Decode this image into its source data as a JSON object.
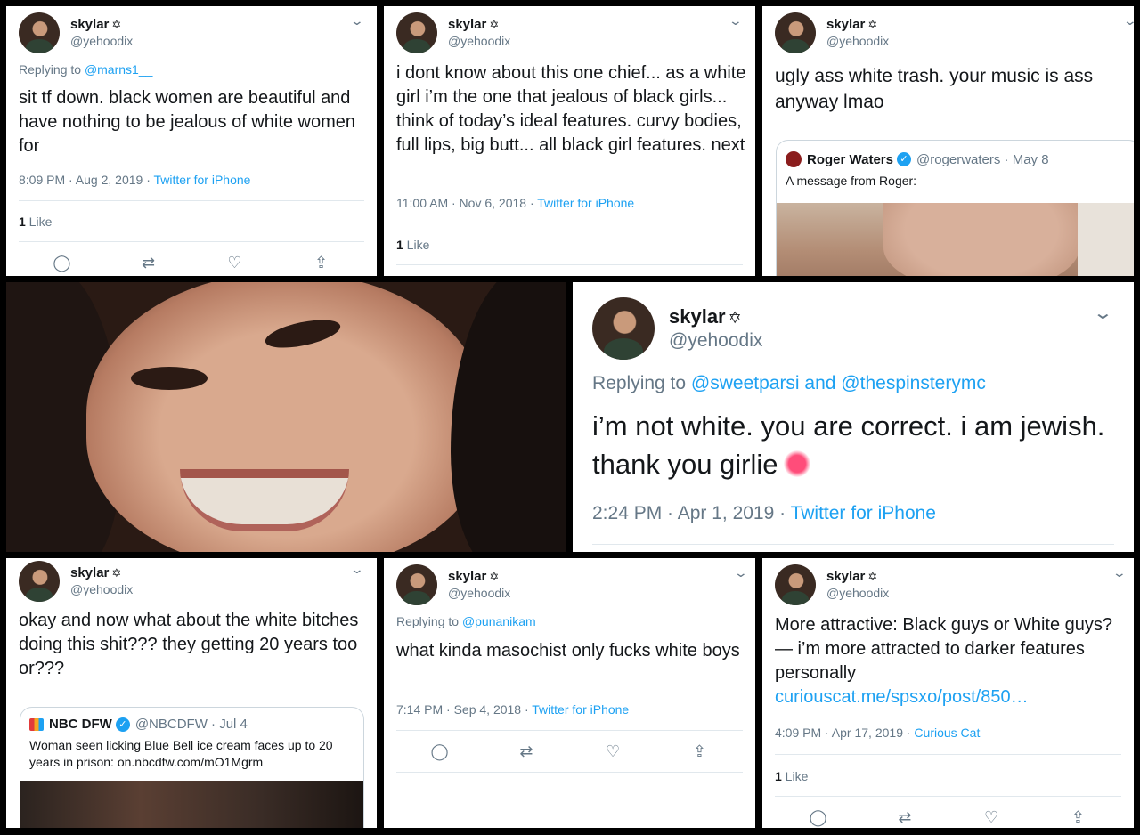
{
  "user": {
    "name": "skylar",
    "star": "✡",
    "handle": "@yehoodix"
  },
  "colors": {
    "accent": "#1da1f2",
    "muted": "#657786",
    "text": "#14171a"
  },
  "actions": {
    "reply_icon": "◯",
    "retweet_icon": "⇄",
    "like_icon": "♡",
    "share_icon": "⇪",
    "chevron": "⌄"
  },
  "tweets": {
    "t1": {
      "reply_prefix": "Replying to ",
      "reply_to": "@marns1__",
      "text": "sit tf down. black women are beautiful and have nothing to be jealous of white women for",
      "time": "8:09 PM · Aug 2, 2019 · ",
      "source": "Twitter for iPhone",
      "like_count": "1",
      "like_label": " Like"
    },
    "t2": {
      "text": "i dont know about this one chief... as a white girl i’m the one that jealous of black girls... think of today’s ideal features. curvy bodies, full lips, big butt... all black girl features. next",
      "time": "11:00 AM · Nov 6, 2018 · ",
      "source": "Twitter for iPhone",
      "like_count": "1",
      "like_label": " Like"
    },
    "t3": {
      "text": "ugly ass white trash. your music is ass anyway lmao",
      "quote": {
        "name": "Roger Waters",
        "handle": "@rogerwaters · May 8",
        "text": "A message from Roger:"
      }
    },
    "t5": {
      "reply_prefix": "Replying to ",
      "reply_to": "@sweetparsi and @thespinsterymc",
      "text": "i’m not white. you are correct. i am jewish. thank you girlie",
      "time": "2:24 PM · Apr 1, 2019 · ",
      "source": "Twitter for iPhone"
    },
    "t6": {
      "text": "okay and now what about the white bitches doing this shit??? they getting 20 years too or???",
      "quote": {
        "name": "NBC DFW",
        "handle": "@NBCDFW · Jul 4",
        "text": "Woman seen licking Blue Bell ice cream faces up to 20 years in prison: on.nbcdfw.com/mO1Mgrm"
      }
    },
    "t7": {
      "reply_prefix": "Replying to ",
      "reply_to": "@punanikam_",
      "text": "what kinda masochist only fucks white boys",
      "time": "7:14 PM · Sep 4, 2018 · ",
      "source": "Twitter for iPhone"
    },
    "t8": {
      "text": "More attractive: Black guys or White guys? — i’m more attracted to darker features personally",
      "link": "curiouscat.me/spsxo/post/850…",
      "time": "4:09 PM · Apr 17, 2019 · ",
      "source": "Curious Cat",
      "like_count": "1",
      "like_label": " Like"
    }
  }
}
